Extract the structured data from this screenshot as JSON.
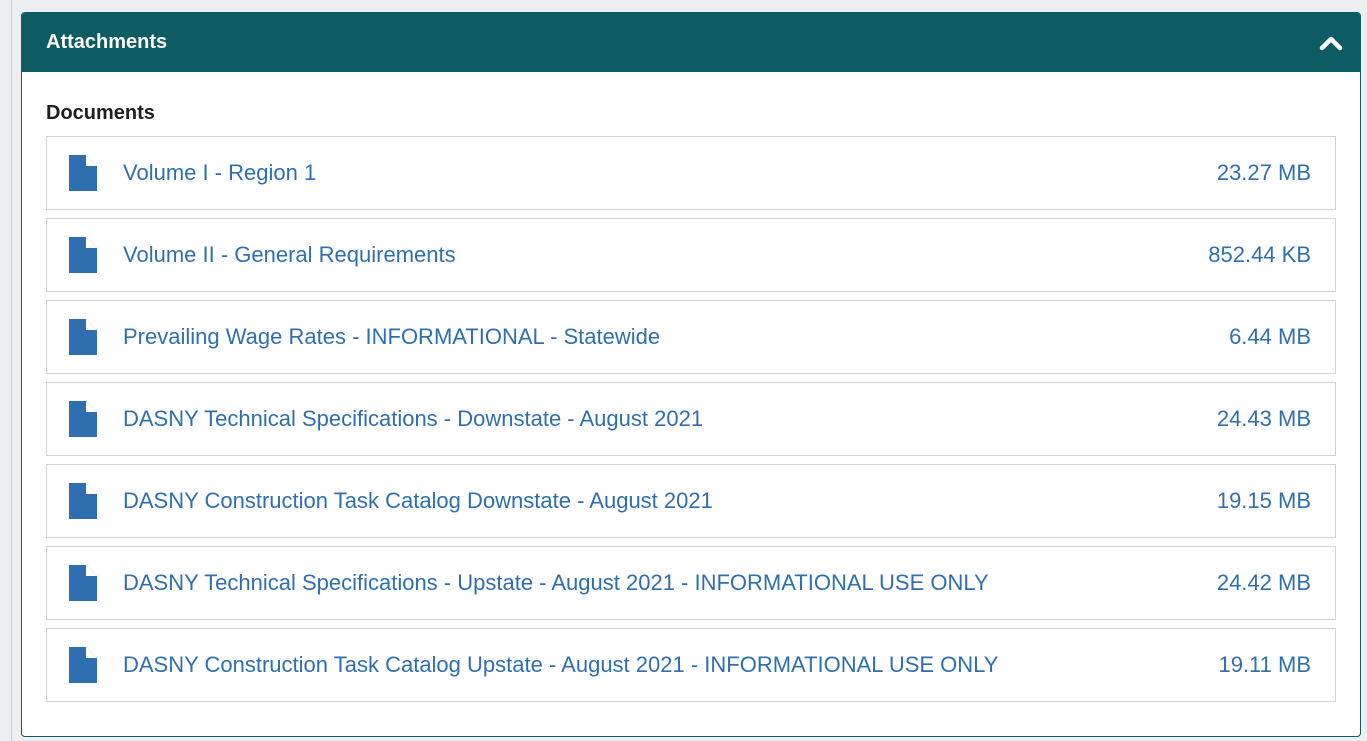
{
  "panel": {
    "title": "Attachments",
    "collapse_icon": "chevron-up-icon",
    "header_color": "#0e5c63"
  },
  "documents": {
    "section_title": "Documents",
    "link_color": "#2f6fb0",
    "icon": "file-icon",
    "items": [
      {
        "name": "Volume I - Region 1",
        "size": "23.27 MB"
      },
      {
        "name": "Volume II - General Requirements",
        "size": "852.44 KB"
      },
      {
        "name": "Prevailing Wage Rates - INFORMATIONAL - Statewide",
        "size": "6.44 MB"
      },
      {
        "name": "DASNY Technical Specifications - Downstate - August 2021",
        "size": "24.43 MB"
      },
      {
        "name": "DASNY Construction Task Catalog Downstate - August 2021",
        "size": "19.15 MB"
      },
      {
        "name": "DASNY Technical Specifications - Upstate - August 2021 - INFORMATIONAL USE ONLY",
        "size": "24.42 MB"
      },
      {
        "name": "DASNY Construction Task Catalog Upstate - August 2021 - INFORMATIONAL USE ONLY",
        "size": "19.11 MB"
      }
    ]
  }
}
